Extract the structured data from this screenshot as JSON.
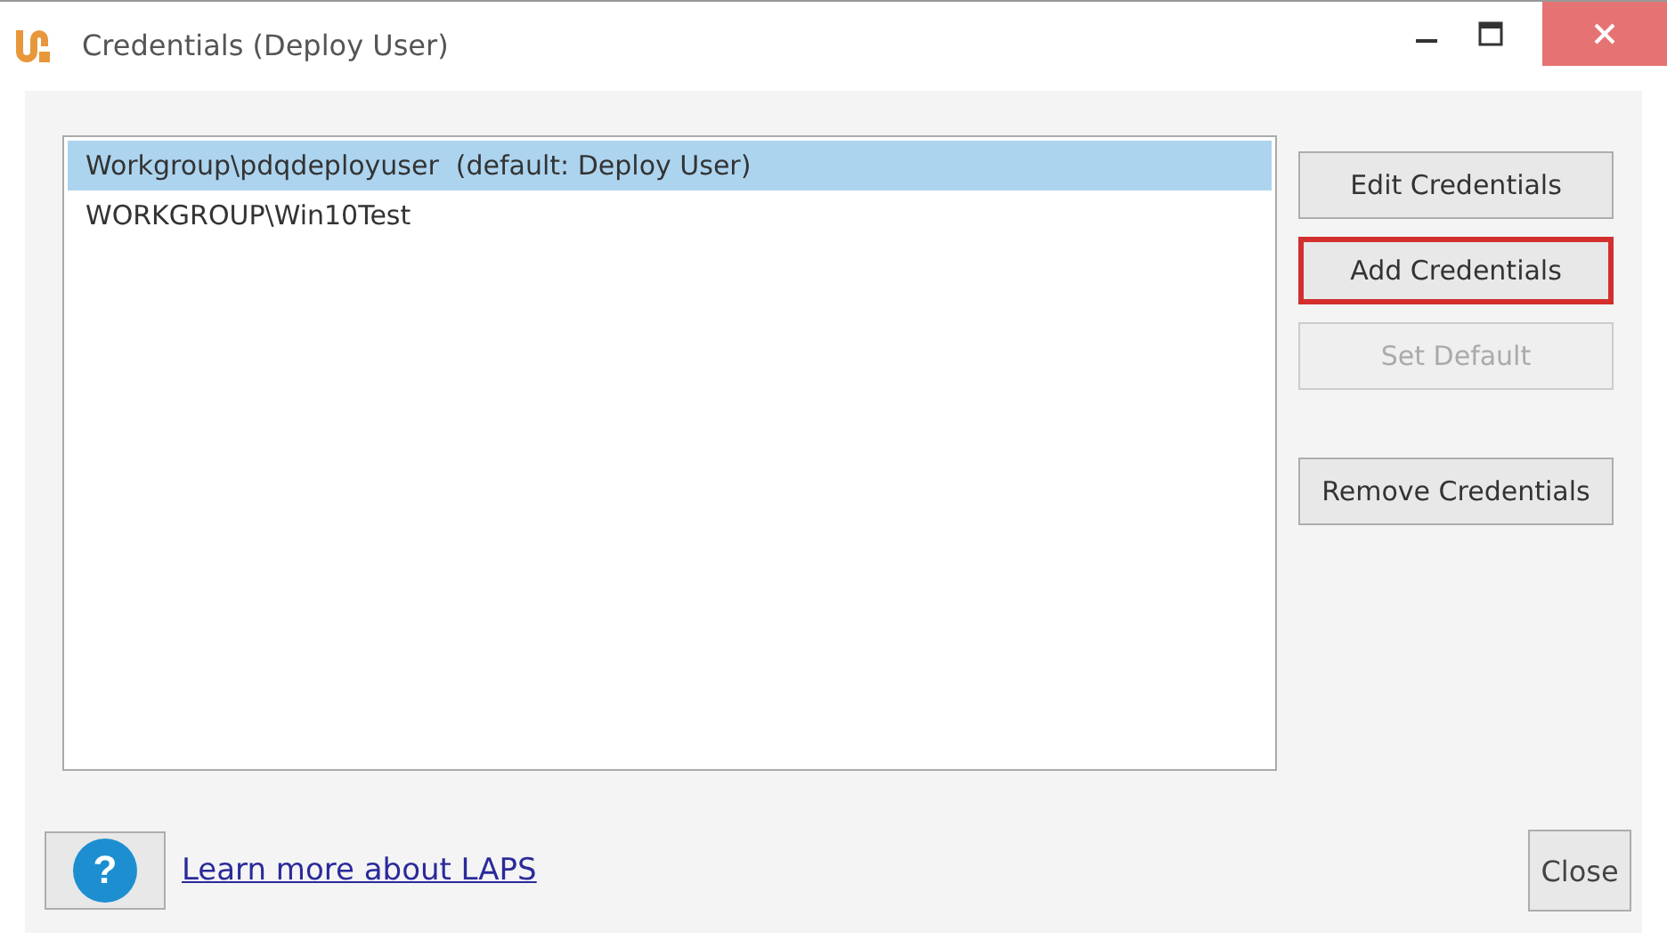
{
  "window": {
    "title": "Credentials (Deploy User)"
  },
  "credentials": [
    {
      "label": "Workgroup\\pdqdeployuser  (default: Deploy User)",
      "selected": true
    },
    {
      "label": "WORKGROUP\\Win10Test",
      "selected": false
    }
  ],
  "buttons": [
    {
      "label": "Edit Credentials",
      "disabled": false,
      "highlighted": false
    },
    {
      "label": "Add Credentials",
      "disabled": false,
      "highlighted": true
    },
    {
      "label": "Set Default",
      "disabled": true,
      "highlighted": false
    },
    {
      "label": "Remove Credentials",
      "disabled": false,
      "highlighted": false
    }
  ],
  "help_button": {
    "label": "?"
  },
  "link": "Learn more about LAPS",
  "close_button": "Close"
}
